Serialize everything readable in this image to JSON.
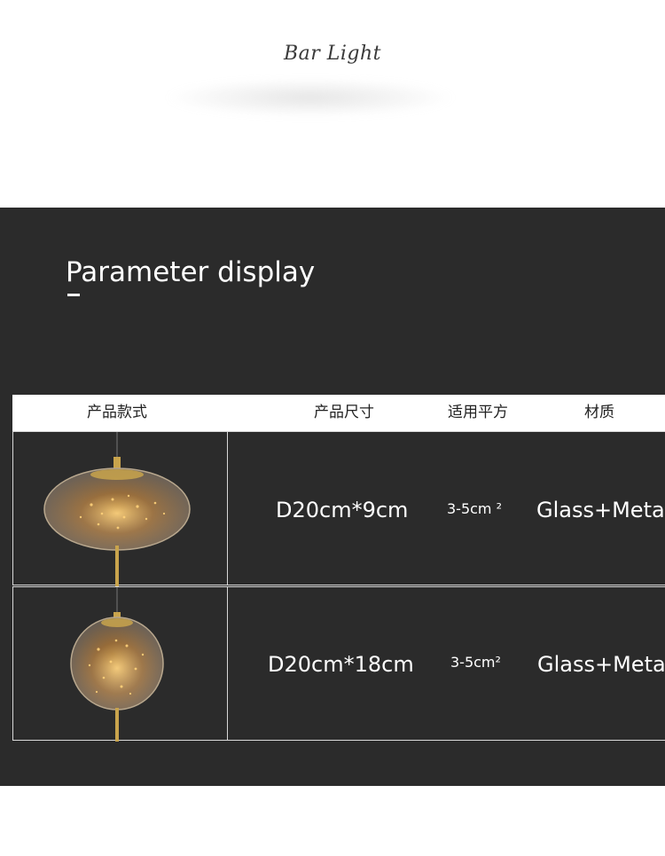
{
  "header": {
    "title": "Bar Light"
  },
  "section": {
    "title": "Parameter display"
  },
  "table": {
    "columns": [
      "产品款式",
      "产品尺寸",
      "适用平方",
      "材质"
    ],
    "rows": [
      {
        "size": "D20cm*9cm",
        "area": "3-5cm ²",
        "material": "Glass+Meta",
        "style_icon": "oval-glass-pendant-lamp"
      },
      {
        "size": "D20cm*18cm",
        "area": "3-5cm²",
        "material": "Glass+Meta",
        "style_icon": "globe-glass-pendant-lamp"
      }
    ]
  },
  "colors": {
    "background_dark": "#2b2b2b",
    "text_light": "#ffffff",
    "gold": "#c9a44c"
  }
}
